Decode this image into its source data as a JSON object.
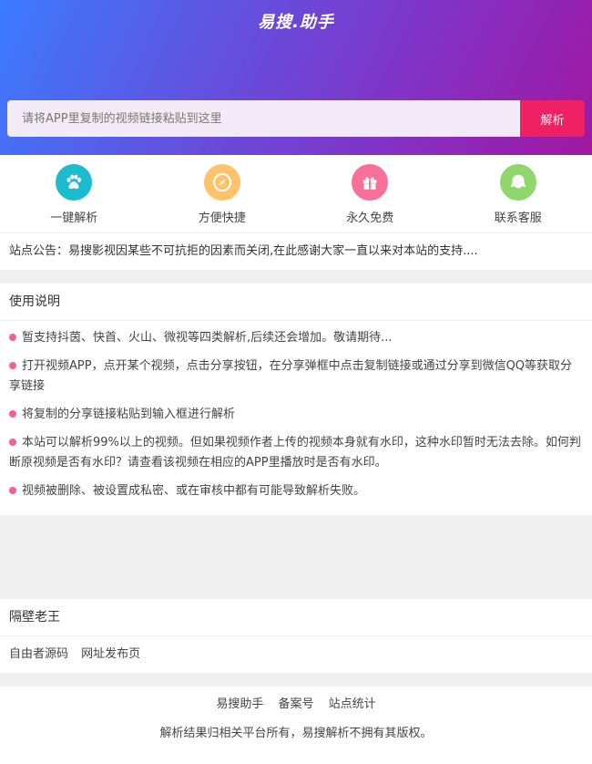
{
  "header": {
    "logo_text": "易搜.助手"
  },
  "search": {
    "placeholder": "请将APP里复制的视频链接粘贴到这里",
    "value": "",
    "button_label": "解析"
  },
  "features": [
    {
      "label": "一键解析",
      "icon": "paw-icon",
      "color": "#1bbcd0"
    },
    {
      "label": "方便快捷",
      "icon": "compass-icon",
      "color": "#ffc36b"
    },
    {
      "label": "永久免费",
      "icon": "gift-icon",
      "color": "#f7709a"
    },
    {
      "label": "联系客服",
      "icon": "chat-bubble-icon",
      "color": "#8fd66b"
    }
  ],
  "notice": {
    "text": "站点公告：易搜影视因某些不可抗拒的因素而关闭,在此感谢大家一直以来对本站的支持...."
  },
  "instructions": {
    "title": "使用说明",
    "items": [
      "暂支持抖茵、快首、火山、微视等四类解析,后续还会增加。敬请期待...",
      "打开视频APP，点开某个视频，点击分享按钮，在分享弹框中点击复制链接或通过分享到微信QQ等获取分享链接",
      "将复制的分享链接粘贴到输入框进行解析",
      "本站可以解析99%以上的视频。但如果视频作者上传的视频本身就有水印，这种水印暂时无法去除。如何判断原视频是否有水印？请查看该视频在相应的APP里播放时是否有水印。",
      "视频被删除、被设置成私密、或在审核中都有可能导致解析失败。"
    ],
    "bullet_color": "#f06292"
  },
  "neighbor": {
    "title": "隔壁老王",
    "links": [
      "自由者源码",
      "网址发布页"
    ]
  },
  "footer": {
    "links": [
      "易搜助手",
      "备案号",
      "站点统计"
    ],
    "copyright": "解析结果归相关平台所有，易搜解析不拥有其版权。"
  },
  "colors": {
    "gradient_start": "#3b7bff",
    "gradient_end": "#a0189f",
    "button": "#ef2064"
  }
}
